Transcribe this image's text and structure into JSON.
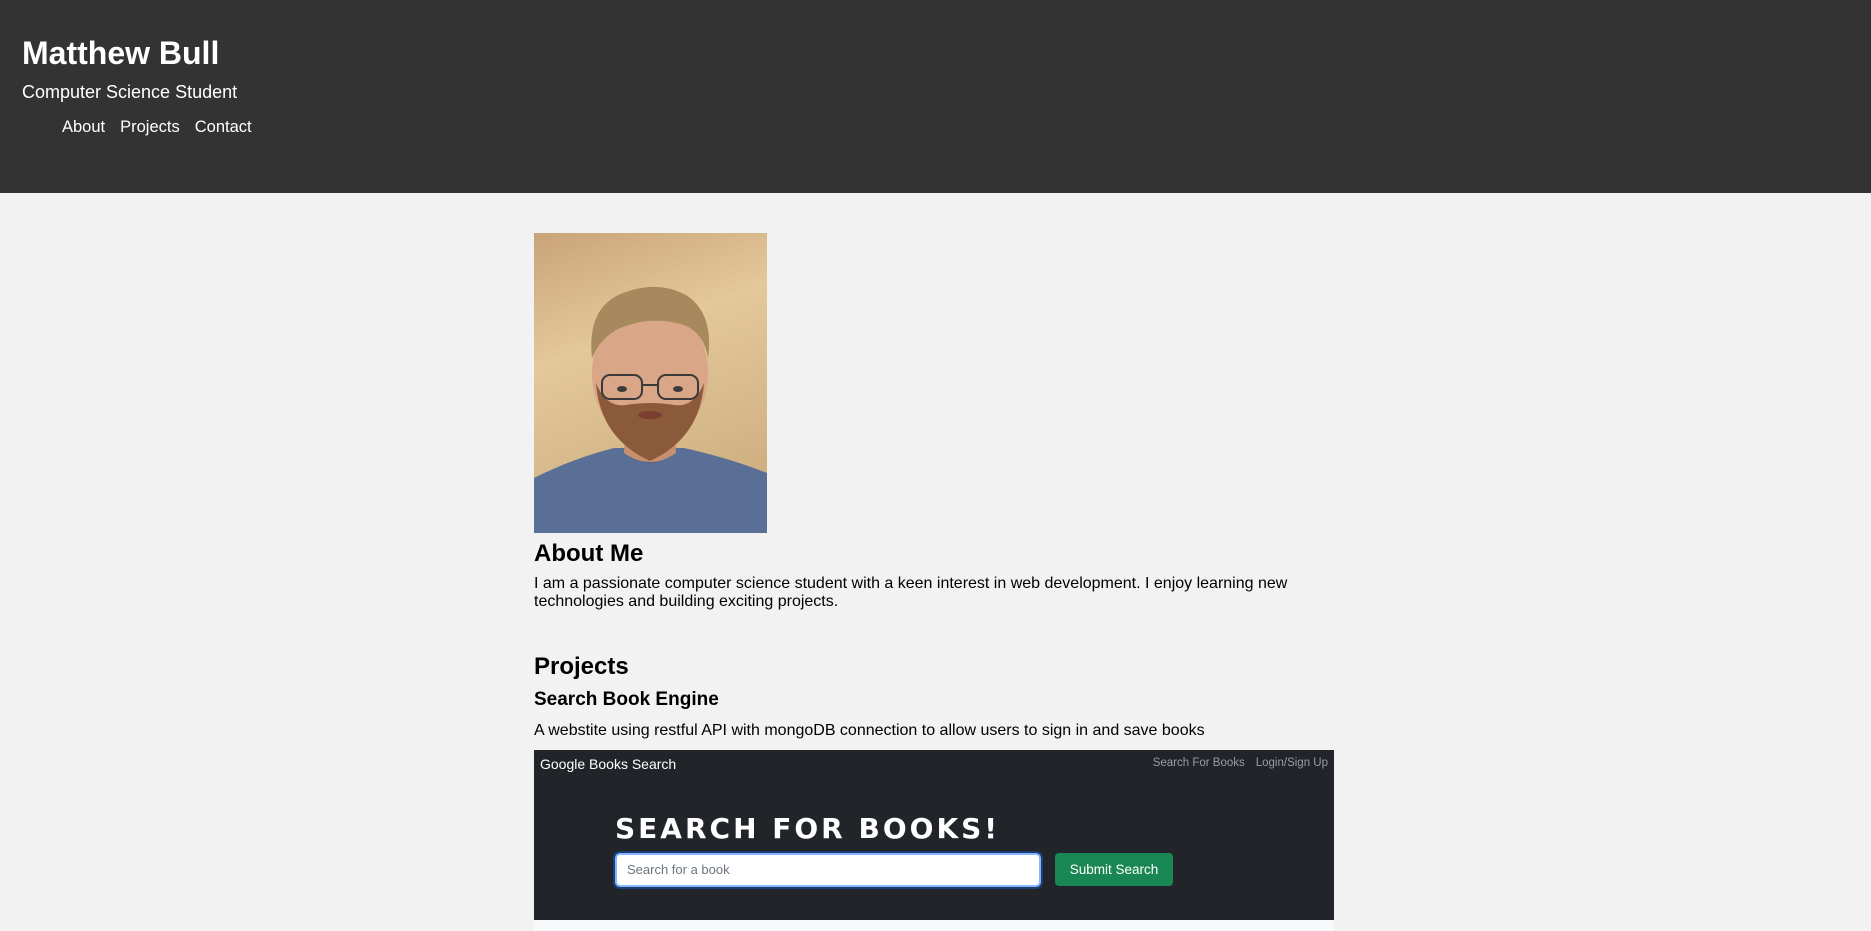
{
  "header": {
    "name": "Matthew Bull",
    "subtitle": "Computer Science Student",
    "nav": [
      {
        "label": "About"
      },
      {
        "label": "Projects"
      },
      {
        "label": "Contact"
      }
    ]
  },
  "about": {
    "title": "About Me",
    "text": "I am a passionate computer science student with a keen interest in web development. I enjoy learning new technologies and building exciting projects."
  },
  "projects": {
    "title": "Projects",
    "items": [
      {
        "title": "Search Book Engine",
        "description": "A webstite using restful API with mongoDB connection to allow users to sign in and save books",
        "screenshot": {
          "brand": "Google Books Search",
          "links": [
            "Search For Books",
            "Login/Sign Up"
          ],
          "heading": "SEARCH FOR BOOKS!",
          "input_placeholder": "Search for a book",
          "button_label": "Submit Search"
        }
      }
    ]
  }
}
